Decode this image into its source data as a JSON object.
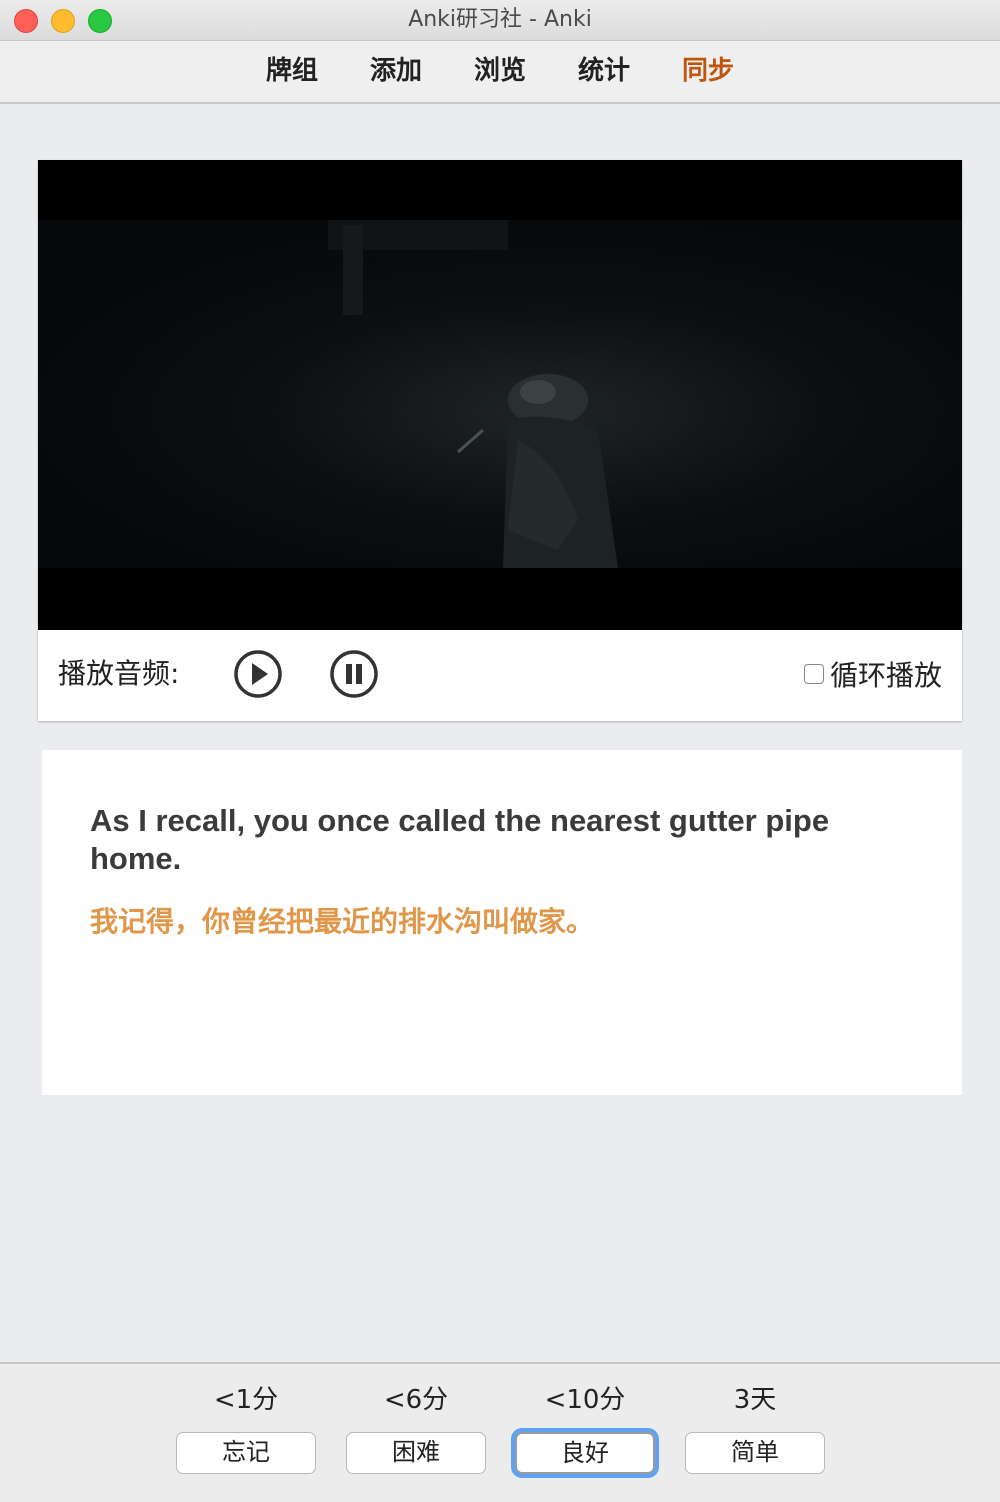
{
  "window": {
    "title": "Anki研习社 - Anki"
  },
  "toolbar": {
    "items": [
      {
        "label": "牌组"
      },
      {
        "label": "添加"
      },
      {
        "label": "浏览"
      },
      {
        "label": "统计"
      },
      {
        "label": "同步"
      }
    ],
    "active_color": "#c0560e"
  },
  "player": {
    "label": "播放音频:",
    "play_icon": "play-circle-icon",
    "pause_icon": "pause-circle-icon",
    "loop_label": "循环播放",
    "loop_checked": false
  },
  "card": {
    "english": "As I recall, you once called the nearest gutter pipe home.",
    "chinese": "我记得，你曾经把最近的排水沟叫做家。",
    "chinese_color": "#e0974a"
  },
  "answers": [
    {
      "due": "<1分",
      "label": "忘记"
    },
    {
      "due": "<6分",
      "label": "困难"
    },
    {
      "due": "<10分",
      "label": "良好"
    },
    {
      "due": "3天",
      "label": "简单"
    }
  ],
  "focus_color": "#5da2f5"
}
